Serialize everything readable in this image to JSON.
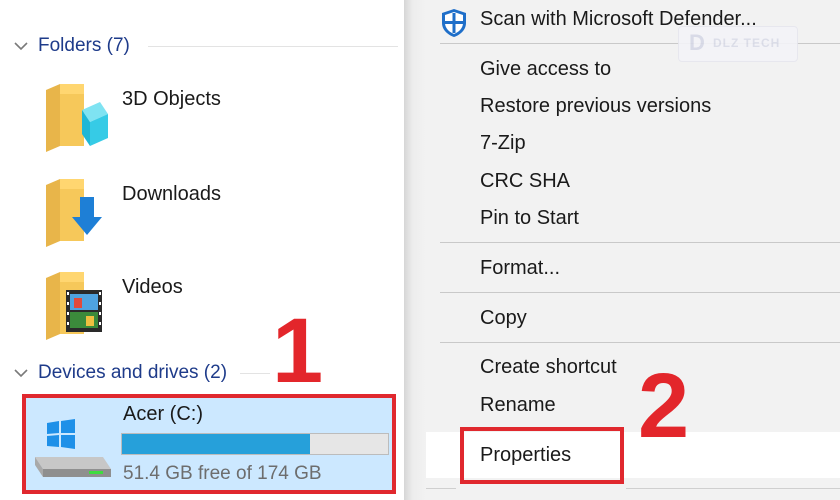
{
  "explorer": {
    "folders_header": "Folders (7)",
    "folders": [
      {
        "label": "3D Objects",
        "icon": "3d-objects-folder-icon"
      },
      {
        "label": "Downloads",
        "icon": "downloads-folder-icon"
      },
      {
        "label": "Videos",
        "icon": "videos-folder-icon"
      }
    ],
    "devices_header": "Devices and drives (2)",
    "drive": {
      "label": "Acer (C:)",
      "free_text": "51.4 GB free of 174 GB",
      "used_fraction": 0.705,
      "icon": "windows-drive-icon"
    }
  },
  "annotations": {
    "step1": "1",
    "step2": "2",
    "color": "#e3262b"
  },
  "context_menu": {
    "defender": "Scan with Microsoft Defender...",
    "give_access": "Give access to",
    "restore": "Restore previous versions",
    "zip": "7-Zip",
    "crc": "CRC SHA",
    "pin": "Pin to Start",
    "format": "Format...",
    "copy": "Copy",
    "create_shortcut": "Create shortcut",
    "rename": "Rename",
    "properties": "Properties"
  },
  "watermark": {
    "text": "DLZ TECH"
  },
  "colors": {
    "selection_bg": "#cce8ff",
    "drive_bar_fill": "#26a0da",
    "header_text": "#1e3b8a",
    "menu_bg": "#f2f2f2"
  }
}
